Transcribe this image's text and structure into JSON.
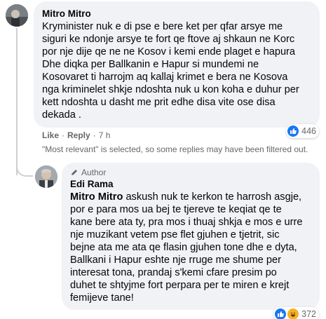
{
  "comment": {
    "author": "Mitro Mitro",
    "lines": [
      "Kryminister nuk e di pse e bere ket per qfar arsye me",
      "siguri ke ndonje arsye te fort qe ftove aj shkaun ne Korc",
      "por nje dije qe ne ne Kosov i kemi ende plaget e hapura",
      "Dhe diqka per Ballkanin e Hapur si mundemi ne",
      "Kosovaret ti harrojm aq kallaj krimet e bera ne Kosova",
      "nga kriminelet shkje ndoshta nuk u kon koha e duhur per",
      "kett ndoshta u dasht me prit edhe disa vite ose disa",
      "dekada ."
    ],
    "actions": {
      "like": "Like",
      "reply": "Reply",
      "sep": "·",
      "time": "7 h"
    },
    "reaction_count": "446",
    "reaction_icons": [
      "like-icon"
    ]
  },
  "filter_note": "\"Most relevant\" is selected, so some replies may have been filtered out.",
  "reply": {
    "badge": "Author",
    "author": "Edi Rama",
    "mention": "Mitro Mitro",
    "first_line_rest": " askush nuk te kerkon te harrosh asgje,",
    "lines": [
      "por e para mos ua bej te tjereve te keqiat qe te",
      "kane bere ata ty, pra mos i thuaj shkja e mos e urre",
      "nje muzikant vetem pse flet gjuhen e tjetrit, sic",
      "bejne ata me ata qe flasin gjuhen tone dhe e dyta,",
      "Ballkani i Hapur eshte nje rruge me shume per",
      "interesat tona, prandaj s'kemi cfare presim po",
      "duhet te shtyjme fort perpara per te miren e krejt",
      "femijeve tane!"
    ],
    "reaction_count": "372",
    "reaction_icons": [
      "like-icon",
      "haha-icon"
    ]
  },
  "colors": {
    "bubble": "#f0f2f5",
    "like_blue": "#1877f2",
    "meta_gray": "#65676b",
    "haha_yellow": "#f7b125"
  }
}
